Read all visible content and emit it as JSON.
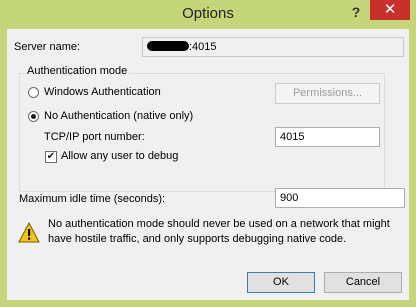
{
  "window": {
    "title": "Options",
    "help_glyph": "?",
    "close_glyph": "✕"
  },
  "server": {
    "label": "Server name:",
    "value_suffix": ":4015"
  },
  "auth": {
    "group_label": "Authentication mode",
    "windows_label": "Windows Authentication",
    "windows_checked": false,
    "permissions_label": "Permissions...",
    "none_label": "No Authentication (native only)",
    "none_checked": true,
    "port_label": "TCP/IP port number:",
    "port_value": "4015",
    "allow_any_label": "Allow any user to debug",
    "allow_any_checked": true,
    "check_glyph": "✔"
  },
  "idle": {
    "label": "Maximum idle time (seconds):",
    "value": "900"
  },
  "warning": {
    "icon": "warning-triangle-icon",
    "text": "No authentication mode should never be used on a network that might have hostile traffic, and only supports debugging native code."
  },
  "buttons": {
    "ok": "OK",
    "cancel": "Cancel"
  },
  "colors": {
    "frame": "#c5d67a",
    "close": "#c7302b",
    "client": "#f0f0f0"
  }
}
